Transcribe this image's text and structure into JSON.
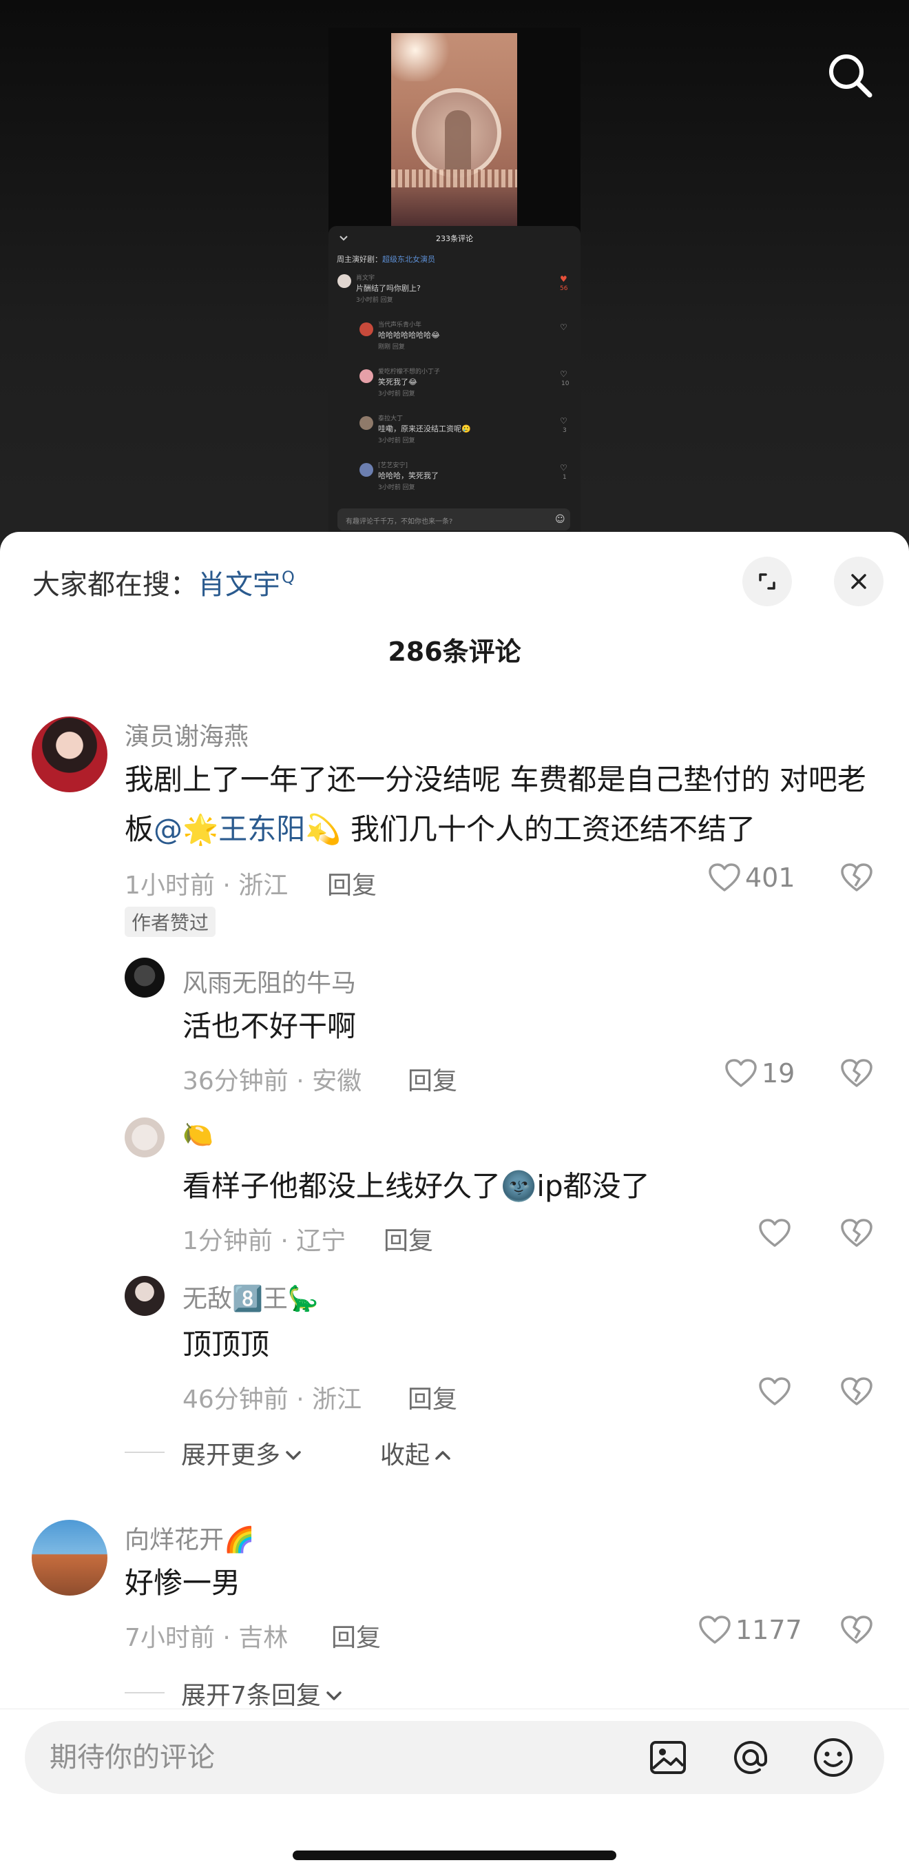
{
  "mini_panel": {
    "title": "233条评论",
    "hint_prefix": "周主演好剧：",
    "hint_link": "超级东北女演员",
    "input_placeholder": "有趣评论千千万，不如你也来一条?",
    "items": [
      {
        "user": "肖文宇",
        "text": "片酬结了吗你剧上?",
        "meta": "3小时前   回复",
        "likes": "56"
      },
      {
        "user": "当代声乐青小年",
        "text": "哈哈哈哈哈哈哈😂",
        "meta": "刚刚   回复",
        "likes": ""
      },
      {
        "user": "爱吃柠檬不想的小丁子",
        "text": "笑死我了😂",
        "meta": "3小时前   回复",
        "likes": "10"
      },
      {
        "user": "泰拉大丁",
        "text": "哇嘞，原来还没结工资呢🥲",
        "meta": "3小时前   回复",
        "likes": "3"
      },
      {
        "user": "[艺艺安宁]",
        "text": "哈哈哈，笑死我了",
        "meta": "3小时前   回复",
        "likes": "1"
      }
    ]
  },
  "search_hint": {
    "prefix": "大家都在搜：",
    "keyword": "肖文宇",
    "icon": "search-icon"
  },
  "comment_count": "286条评论",
  "comments": [
    {
      "user": "演员谢海燕",
      "text_before": "我剧上了一年了还一分没结呢 车费都是自己垫付的 对吧老板",
      "mention": "@🌟王东阳💫",
      "text_after": " 我们几十个人的工资还结不结了",
      "meta": "1小时前 · 浙江",
      "reply": "回复",
      "likes": "401",
      "tag": "作者赞过"
    },
    {
      "user": "风雨无阻的牛马",
      "text": "活也不好干啊",
      "meta": "36分钟前 · 安徽",
      "reply": "回复",
      "likes": "19"
    },
    {
      "user": "🍋",
      "text": "看样子他都没上线好久了🌚ip都没了",
      "meta": "1分钟前 · 辽宁",
      "reply": "回复",
      "likes": ""
    },
    {
      "user": "无敌8️⃣王🦕",
      "text": "顶顶顶",
      "meta": "46分钟前 · 浙江",
      "reply": "回复",
      "likes": ""
    },
    {
      "user": "向烊花开🌈",
      "text": "好惨一男",
      "meta": "7小时前 · 吉林",
      "reply": "回复",
      "likes": "1177"
    }
  ],
  "expand_more": "展开更多",
  "collapse": "收起",
  "expand_replies": "展开7条回复",
  "input_placeholder": "期待你的评论",
  "icons": [
    "image-icon",
    "at-icon",
    "emoji-icon",
    "heart-icon",
    "dislike-icon",
    "close-icon",
    "expand-icon"
  ],
  "colors": {
    "link": "#2a5a8e",
    "mini_heart_red": "#e8503a"
  }
}
